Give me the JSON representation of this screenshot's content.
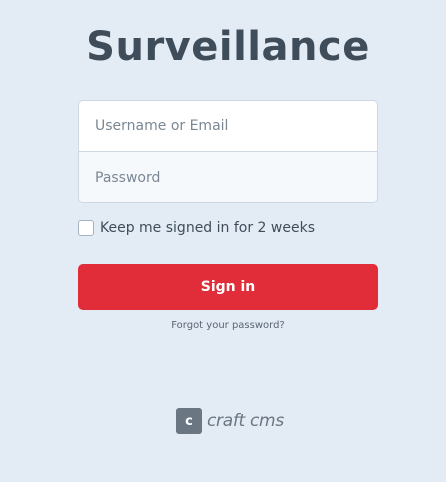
{
  "site": {
    "title": "Surveillance"
  },
  "login": {
    "username_placeholder": "Username or Email",
    "password_placeholder": "Password",
    "remember_label": "Keep me signed in for 2 weeks",
    "remember_checked": false,
    "submit_label": "Sign in",
    "forgot_label": "Forgot your password?"
  },
  "footer": {
    "badge_letter": "c",
    "wordmark": "craft cms",
    "icon": "craft-logo-icon"
  },
  "colors": {
    "background": "#e3ebf5",
    "accent": "#e12d39",
    "title": "#3f4d5a"
  }
}
